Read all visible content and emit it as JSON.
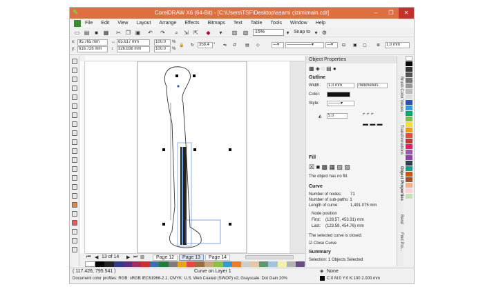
{
  "window": {
    "title": "CorelDRAW X6 (64-Bit) - [C:\\Users\\TSF\\Desktop\\asami çizim\\main.cdr]",
    "minimize": "–",
    "restore": "❐",
    "close": "✕"
  },
  "menu": [
    "File",
    "Edit",
    "View",
    "Layout",
    "Arrange",
    "Effects",
    "Bitmaps",
    "Text",
    "Table",
    "Tools",
    "Window",
    "Help"
  ],
  "toolbar": {
    "zoom": "15%",
    "snap_label": "Snap to"
  },
  "property_bar": {
    "x": "95.765 mm",
    "y": "616.726 mm",
    "width": "65.617 mm",
    "height": "326.838 mm",
    "scale_w": "100.0",
    "scale_h": "100.0",
    "percent": "%",
    "rotation": "358.4",
    "outline_width": "1.0 mm"
  },
  "page_nav": {
    "counter": "13 of 14",
    "tabs": [
      "Page 12",
      "Page 13",
      "Page 14"
    ]
  },
  "status": {
    "coords": "( 117.426, 795.541 )",
    "info": "Curve on Layer 1",
    "color_profiles": "Document color profiles: RGB: sRGB IEC61966-2.1; CMYK: U.S. Web Coated (SWOP) v2; Grayscale: Dot Gain 20%",
    "fill_label": "None",
    "outline_info": "C:0 M:0 Y:0 K:100  2.000 mm"
  },
  "docker": {
    "title": "Object Properties",
    "outline": {
      "header": "Outline",
      "width_label": "Width:",
      "width_value": "1.0 mm",
      "units": "millimeters",
      "color_label": "Color:",
      "style_label": "Style:",
      "miter_value": "5.0"
    },
    "fill": {
      "header": "Fill",
      "note": "The object has no fill."
    },
    "curve": {
      "header": "Curve",
      "nodes": "Number of nodes:",
      "nodes_val": "71",
      "subpaths": "Number of sub-paths: 1",
      "length": "Length of curve:",
      "length_val": "1,491.075 mm",
      "node_position": "Node position",
      "first": "First:",
      "first_val": "(128.57, 453.31) mm",
      "last": "Last:",
      "last_val": "(123.59, 454.76) mm",
      "closed_note": "The selected curve is closed.",
      "close_curve": "Close Curve"
    },
    "summary": {
      "header": "Summary",
      "selection": "Selection: 1 Objects Selected"
    }
  },
  "dock_tabs": [
    "Brush Color Values",
    "Transformations",
    "Object Properties",
    "Bend",
    "Find Pro..."
  ],
  "colors": {
    "titlebar": "#df6e41",
    "app_icon": "#7fd041",
    "selection_blue": "#4a7fd6"
  }
}
